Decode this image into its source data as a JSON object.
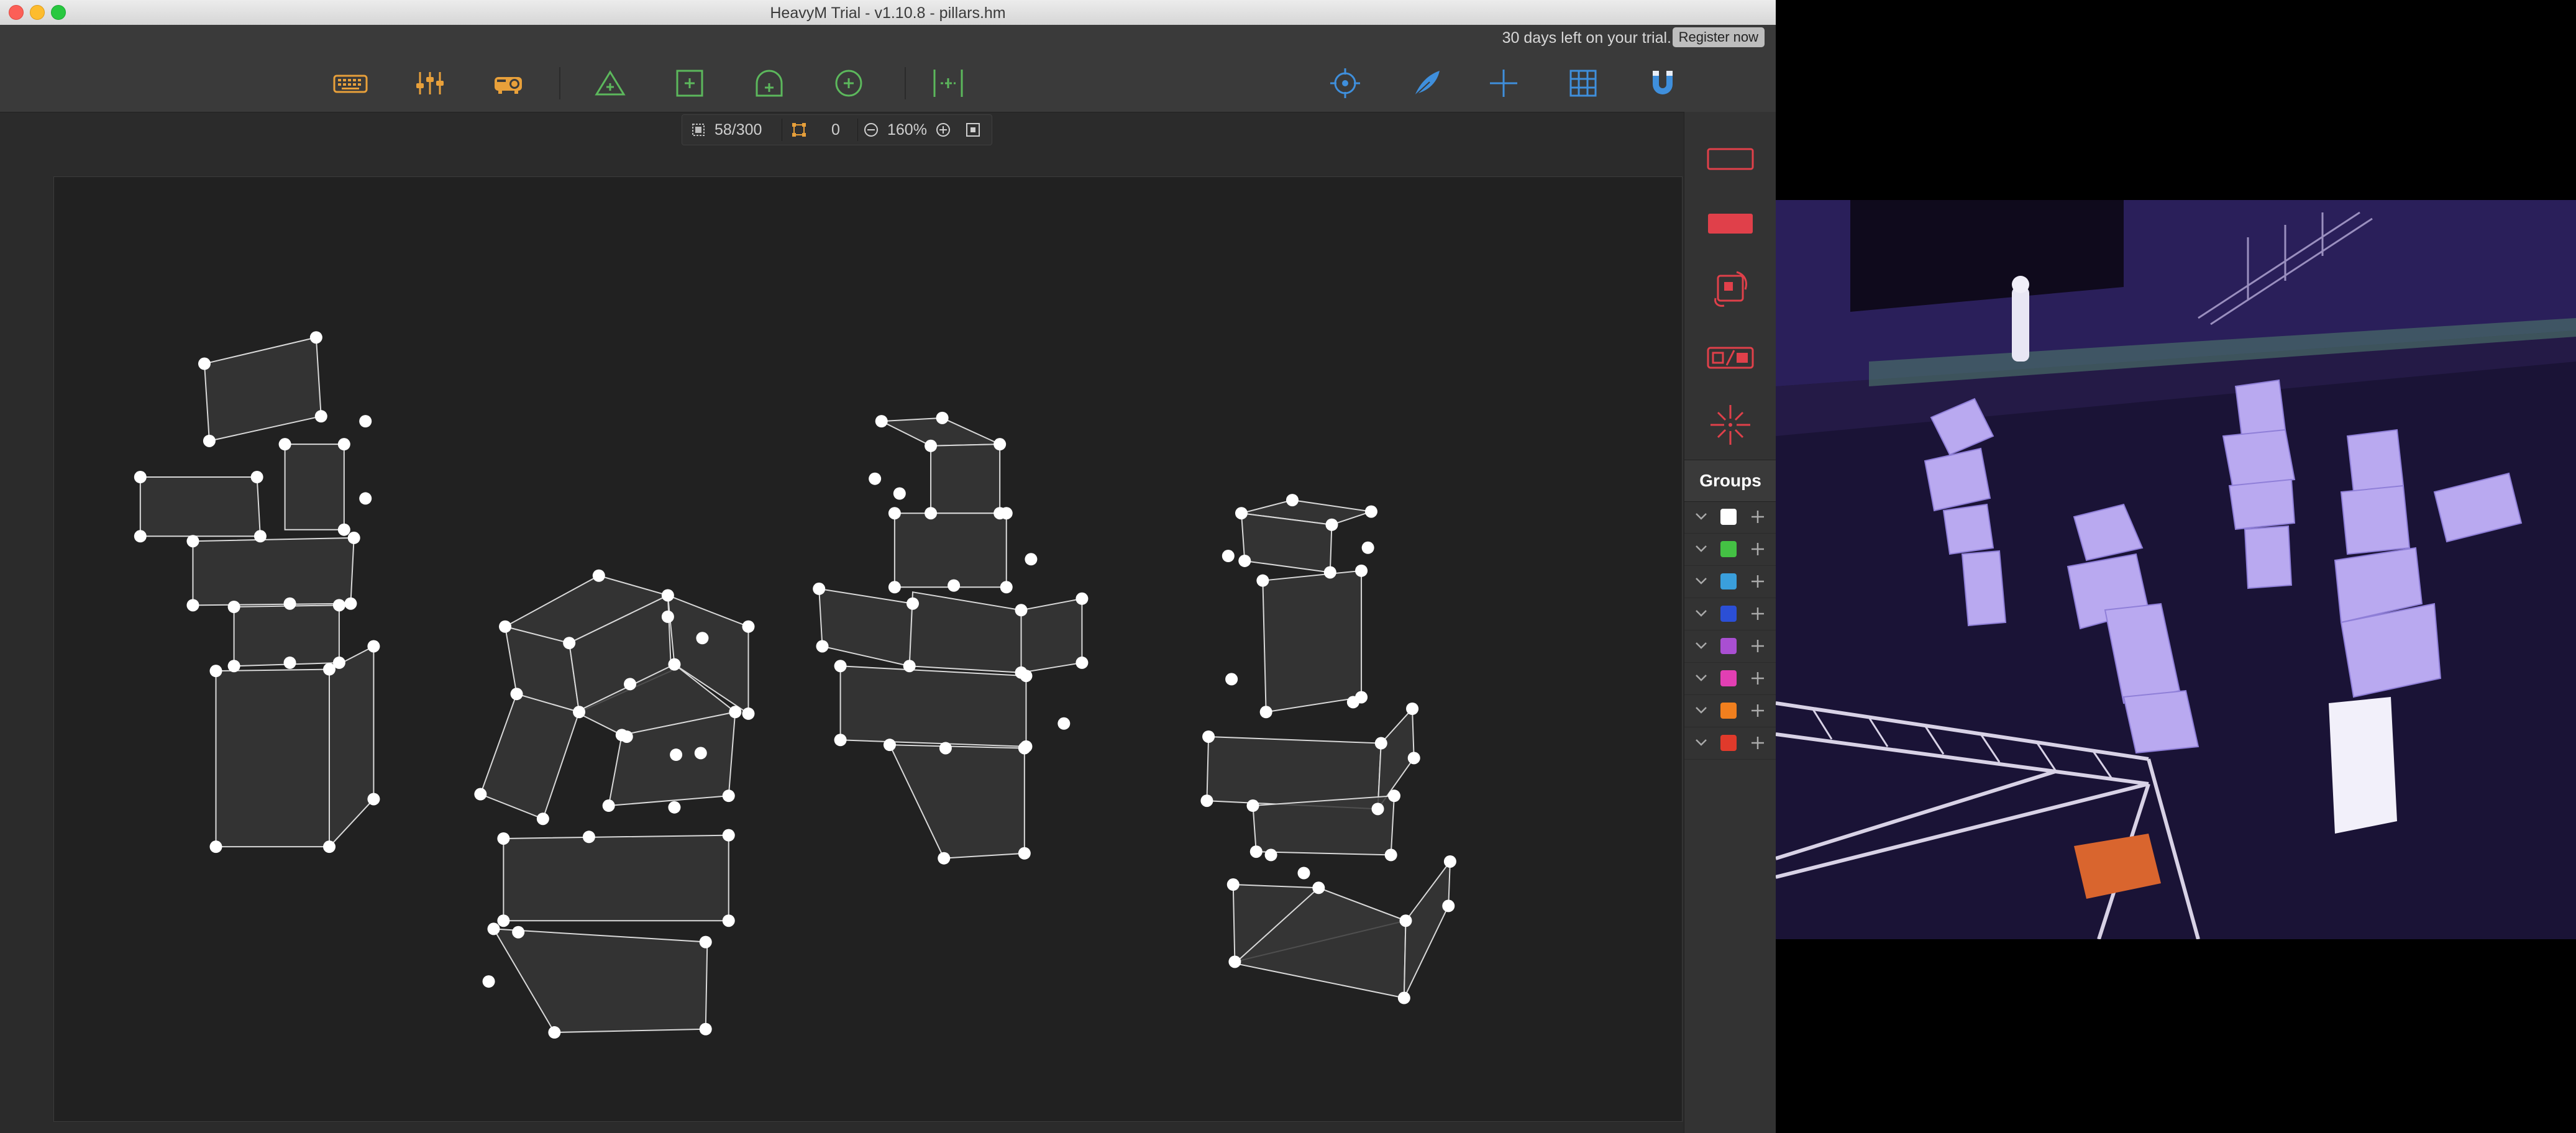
{
  "window": {
    "title": "HeavyM Trial - v1.10.8 - pillars.hm"
  },
  "trial": {
    "message": "30 days left on your trial.",
    "register_label": "Register now"
  },
  "toolbar": {
    "left_tools": [
      "keyboard-icon",
      "sliders-icon",
      "projector-icon"
    ],
    "draw_tools": [
      "triangle-add-icon",
      "square-add-icon",
      "arch-add-icon",
      "circle-add-icon",
      "line-add-icon"
    ],
    "right_tools": [
      "crosshair-icon",
      "feather-icon",
      "plus-cursor-icon",
      "grid-icon",
      "magnet-icon"
    ],
    "accent_orange": "#e8a03a",
    "accent_green": "#5cb85c",
    "accent_blue": "#3f8fdc"
  },
  "zoom": {
    "shapes": "58/300",
    "selected": "0",
    "level": "160%"
  },
  "sidebar": {
    "tools": [
      "outline-shape-icon",
      "filled-shape-icon",
      "transform-icon",
      "swap-icon",
      "center-icon"
    ],
    "accent": "#e0404a",
    "groups_title": "Groups",
    "groups": [
      {
        "color": "#ffffff"
      },
      {
        "color": "#44c144"
      },
      {
        "color": "#3a9fdc"
      },
      {
        "color": "#2b4fd6"
      },
      {
        "color": "#a94fd2"
      },
      {
        "color": "#e23fb3"
      },
      {
        "color": "#f07f1e"
      },
      {
        "color": "#e03a2b"
      }
    ]
  }
}
